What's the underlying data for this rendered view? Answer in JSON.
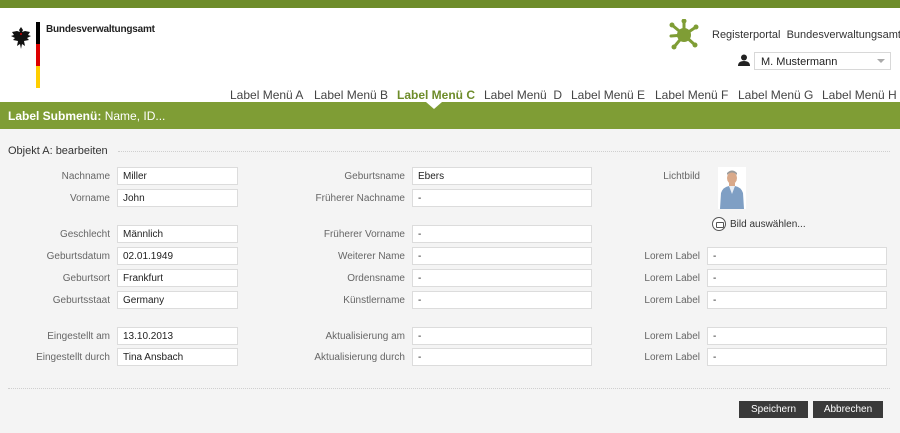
{
  "header": {
    "agency": "Bundesverwaltungsamt",
    "portal": "Registerportal  Bundesverwaltungsamt",
    "user": "M. Mustermann"
  },
  "nav": {
    "items": [
      "Label Menü A",
      "Label Menü B",
      "Label Menü C",
      "Label Menü  D",
      "Label Menü E",
      "Label Menü F",
      "Label Menü G",
      "Label Menü H"
    ],
    "active": "Label Menü C"
  },
  "submenu": {
    "label": "Label Submenü:",
    "value": "Name, ID..."
  },
  "form": {
    "title": "Objekt A: bearbeiten",
    "col1": {
      "nachname": {
        "label": "Nachname",
        "value": "Miller"
      },
      "vorname": {
        "label": "Vorname",
        "value": "John"
      },
      "geschlecht": {
        "label": "Geschlecht",
        "value": "Männlich"
      },
      "geburtsdatum": {
        "label": "Geburtsdatum",
        "value": "02.01.1949"
      },
      "geburtsort": {
        "label": "Geburtsort",
        "value": "Frankfurt"
      },
      "geburtsstaat": {
        "label": "Geburtsstaat",
        "value": "Germany"
      },
      "eingestellt_am": {
        "label": "Eingestellt am",
        "value": "13.10.2013"
      },
      "eingestellt_durch": {
        "label": "Eingestellt durch",
        "value": "Tina Ansbach"
      }
    },
    "col2": {
      "geburtsname": {
        "label": "Geburtsname",
        "value": "Ebers"
      },
      "frueherer_nachname": {
        "label": "Früherer Nachname",
        "value": "-"
      },
      "frueherer_vorname": {
        "label": "Früherer Vorname",
        "value": "-"
      },
      "weiterer_name": {
        "label": "Weiterer Name",
        "value": "-"
      },
      "ordensname": {
        "label": "Ordensname",
        "value": "-"
      },
      "kuenstlername": {
        "label": "Künstlername",
        "value": "-"
      },
      "aktualisierung_am": {
        "label": "Aktualisierung am",
        "value": "-"
      },
      "aktualisierung_durch": {
        "label": "Aktualisierung durch",
        "value": "-"
      }
    },
    "col3": {
      "lichtbild_label": "Lichtbild",
      "bild_auswaehlen": "Bild auswählen...",
      "lorem1": {
        "label": "Lorem Label",
        "value": "-"
      },
      "lorem2": {
        "label": "Lorem Label",
        "value": "-"
      },
      "lorem3": {
        "label": "Lorem Label",
        "value": "-"
      },
      "lorem4": {
        "label": "Lorem Label",
        "value": "-"
      },
      "lorem5": {
        "label": "Lorem Label",
        "value": "-"
      }
    }
  },
  "buttons": {
    "save": "Speichern",
    "cancel": "Abbrechen"
  },
  "colors": {
    "brand_green": "#7f9d35",
    "active_nav": "#6e8c2a",
    "button": "#3a3a3a"
  }
}
